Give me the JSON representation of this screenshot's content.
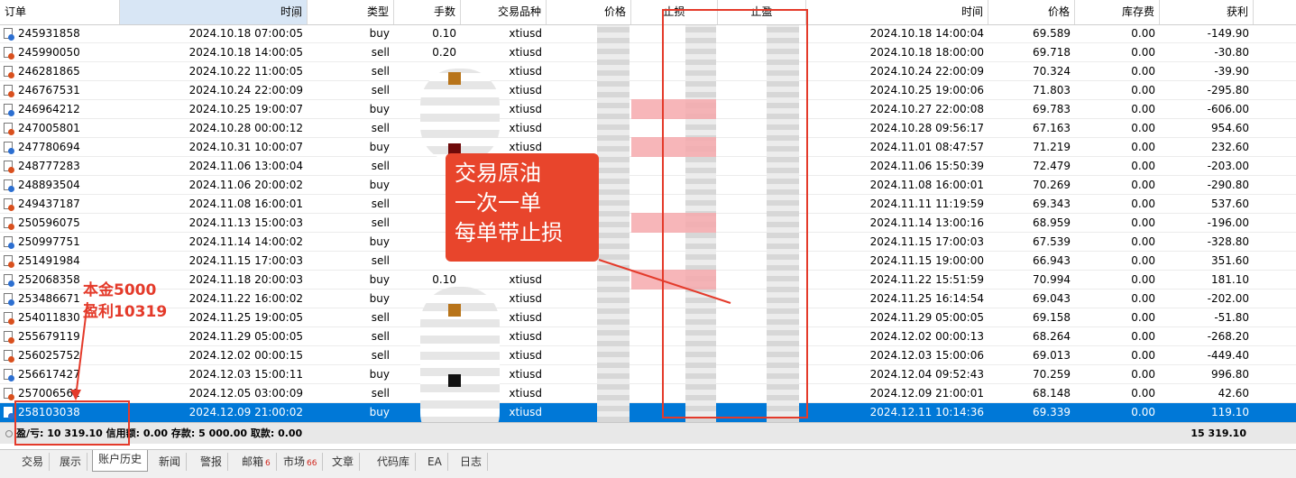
{
  "columns": [
    "订单",
    "时间",
    "类型",
    "手数",
    "交易品种",
    "价格",
    "止损",
    "止盈",
    "时间",
    "价格",
    "库存费",
    "获利"
  ],
  "rows": [
    {
      "ticket": "245931858",
      "open_time": "2024.10.18 07:00:05",
      "type": "buy",
      "volume": "0.10",
      "symbol": "xtiusd",
      "close_time": "2024.10.18 14:00:04",
      "close_price": "69.589",
      "swap": "0.00",
      "profit": "-149.90"
    },
    {
      "ticket": "245990050",
      "open_time": "2024.10.18 14:00:05",
      "type": "sell",
      "volume": "0.20",
      "symbol": "xtiusd",
      "close_time": "2024.10.18 18:00:00",
      "close_price": "69.718",
      "swap": "0.00",
      "profit": "-30.80"
    },
    {
      "ticket": "246281865",
      "open_time": "2024.10.22 11:00:05",
      "type": "sell",
      "volume": "",
      "symbol": "xtiusd",
      "close_time": "2024.10.24 22:00:09",
      "close_price": "70.324",
      "swap": "0.00",
      "profit": "-39.90"
    },
    {
      "ticket": "246767531",
      "open_time": "2024.10.24 22:00:09",
      "type": "sell",
      "volume": "",
      "symbol": "xtiusd",
      "close_time": "2024.10.25 19:00:06",
      "close_price": "71.803",
      "swap": "0.00",
      "profit": "-295.80"
    },
    {
      "ticket": "246964212",
      "open_time": "2024.10.25 19:00:07",
      "type": "buy",
      "volume": "",
      "symbol": "xtiusd",
      "close_time": "2024.10.27 22:00:08",
      "close_price": "69.783",
      "swap": "0.00",
      "profit": "-606.00"
    },
    {
      "ticket": "247005801",
      "open_time": "2024.10.28 00:00:12",
      "type": "sell",
      "volume": "",
      "symbol": "xtiusd",
      "close_time": "2024.10.28 09:56:17",
      "close_price": "67.163",
      "swap": "0.00",
      "profit": "954.60"
    },
    {
      "ticket": "247780694",
      "open_time": "2024.10.31 10:00:07",
      "type": "buy",
      "volume": "",
      "symbol": "xtiusd",
      "close_time": "2024.11.01 08:47:57",
      "close_price": "71.219",
      "swap": "0.00",
      "profit": "232.60"
    },
    {
      "ticket": "248777283",
      "open_time": "2024.11.06 13:00:04",
      "type": "sell",
      "volume": "",
      "symbol": "",
      "close_time": "2024.11.06 15:50:39",
      "close_price": "72.479",
      "swap": "0.00",
      "profit": "-203.00"
    },
    {
      "ticket": "248893504",
      "open_time": "2024.11.06 20:00:02",
      "type": "buy",
      "volume": "",
      "symbol": "",
      "close_time": "2024.11.08 16:00:01",
      "close_price": "70.269",
      "swap": "0.00",
      "profit": "-290.80"
    },
    {
      "ticket": "249437187",
      "open_time": "2024.11.08 16:00:01",
      "type": "sell",
      "volume": "",
      "symbol": "",
      "close_time": "2024.11.11 11:19:59",
      "close_price": "69.343",
      "swap": "0.00",
      "profit": "537.60"
    },
    {
      "ticket": "250596075",
      "open_time": "2024.11.13 15:00:03",
      "type": "sell",
      "volume": "",
      "symbol": "",
      "close_time": "2024.11.14 13:00:16",
      "close_price": "68.959",
      "swap": "0.00",
      "profit": "-196.00"
    },
    {
      "ticket": "250997751",
      "open_time": "2024.11.14 14:00:02",
      "type": "buy",
      "volume": "",
      "symbol": "",
      "close_time": "2024.11.15 17:00:03",
      "close_price": "67.539",
      "swap": "0.00",
      "profit": "-328.80"
    },
    {
      "ticket": "251491984",
      "open_time": "2024.11.15 17:00:03",
      "type": "sell",
      "volume": "",
      "symbol": "",
      "close_time": "2024.11.15 19:00:00",
      "close_price": "66.943",
      "swap": "0.00",
      "profit": "351.60"
    },
    {
      "ticket": "252068358",
      "open_time": "2024.11.18 20:00:03",
      "type": "buy",
      "volume": "0.10",
      "symbol": "xtiusd",
      "close_time": "2024.11.22 15:51:59",
      "close_price": "70.994",
      "swap": "0.00",
      "profit": "181.10"
    },
    {
      "ticket": "253486671",
      "open_time": "2024.11.22 16:00:02",
      "type": "buy",
      "volume": "",
      "symbol": "xtiusd",
      "close_time": "2024.11.25 16:14:54",
      "close_price": "69.043",
      "swap": "0.00",
      "profit": "-202.00"
    },
    {
      "ticket": "254011830",
      "open_time": "2024.11.25 19:00:05",
      "type": "sell",
      "volume": "",
      "symbol": "xtiusd",
      "close_time": "2024.11.29 05:00:05",
      "close_price": "69.158",
      "swap": "0.00",
      "profit": "-51.80"
    },
    {
      "ticket": "255679119",
      "open_time": "2024.11.29 05:00:05",
      "type": "sell",
      "volume": "",
      "symbol": "xtiusd",
      "close_time": "2024.12.02 00:00:13",
      "close_price": "68.264",
      "swap": "0.00",
      "profit": "-268.20"
    },
    {
      "ticket": "256025752",
      "open_time": "2024.12.02 00:00:15",
      "type": "sell",
      "volume": "",
      "symbol": "xtiusd",
      "close_time": "2024.12.03 15:00:06",
      "close_price": "69.013",
      "swap": "0.00",
      "profit": "-449.40"
    },
    {
      "ticket": "256617427",
      "open_time": "2024.12.03 15:00:11",
      "type": "buy",
      "volume": "",
      "symbol": "xtiusd",
      "close_time": "2024.12.04 09:52:43",
      "close_price": "70.259",
      "swap": "0.00",
      "profit": "996.80"
    },
    {
      "ticket": "257006561",
      "open_time": "2024.12.05 03:00:09",
      "type": "sell",
      "volume": "",
      "symbol": "xtiusd",
      "close_time": "2024.12.09 21:00:01",
      "close_price": "68.148",
      "swap": "0.00",
      "profit": "42.60"
    },
    {
      "ticket": "258103038",
      "open_time": "2024.12.09 21:00:02",
      "type": "buy",
      "volume": "",
      "symbol": "xtiusd",
      "close_time": "2024.12.11 10:14:36",
      "close_price": "69.339",
      "swap": "0.00",
      "profit": "119.10"
    }
  ],
  "summary": {
    "text": "盈/亏: 10 319.10  信用额: 0.00  存款: 5 000.00  取款: 0.00",
    "total": "15 319.10"
  },
  "tabs": [
    {
      "label": "交易",
      "badge": ""
    },
    {
      "label": "展示",
      "badge": ""
    },
    {
      "label": "账户历史",
      "badge": ""
    },
    {
      "label": "新闻",
      "badge": ""
    },
    {
      "label": "警报",
      "badge": ""
    },
    {
      "label": "邮箱",
      "badge": "6"
    },
    {
      "label": "市场",
      "badge": "66"
    },
    {
      "label": "文章",
      "badge": ""
    },
    {
      "label": "代码库",
      "badge": ""
    },
    {
      "label": "EA",
      "badge": ""
    },
    {
      "label": "日志",
      "badge": ""
    }
  ],
  "annotations": {
    "callout_lines": [
      "交易原油",
      "一次一单",
      "每单带止损"
    ],
    "note_lines": [
      "本金5000",
      "盈利10319"
    ]
  },
  "colors": {
    "selected_row": "#0078d7",
    "annotation_red": "#e43a2a",
    "callout_bg": "#e8452c"
  }
}
